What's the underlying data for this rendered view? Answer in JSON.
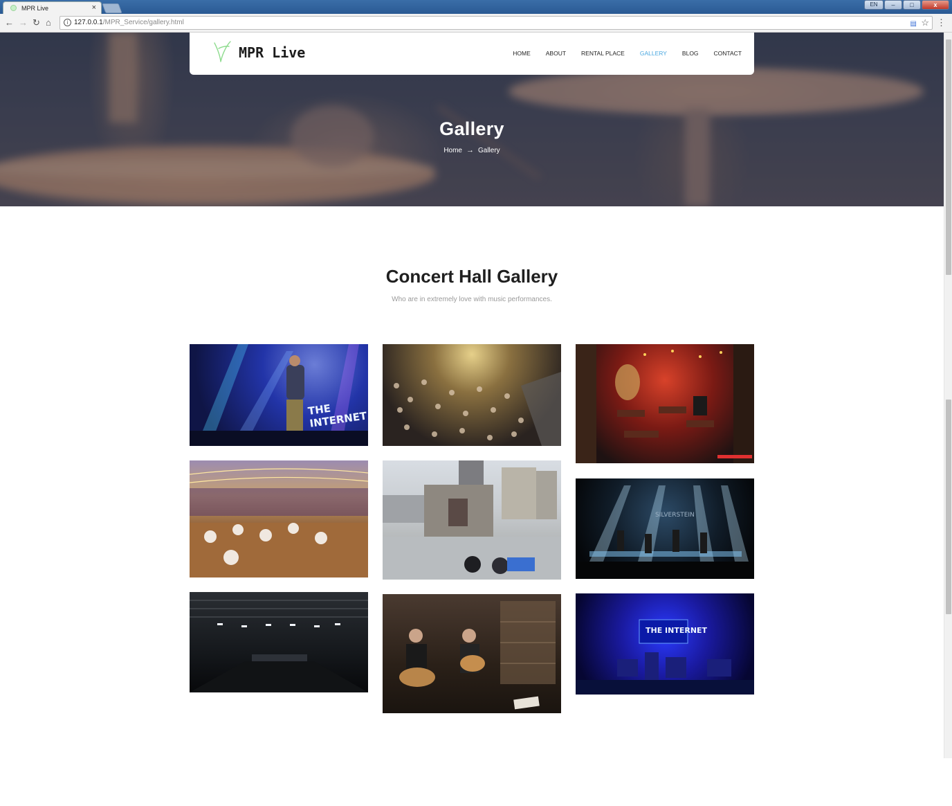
{
  "browser": {
    "tab_title": "MPR Live",
    "tab_close": "×",
    "url_host": "127.0.0.1",
    "url_path": "/MPR_Service/gallery.html",
    "ime_label": "EN",
    "minimize": "–",
    "maximize": "□",
    "close": "x"
  },
  "site": {
    "logo_text": "MPR Live",
    "nav": [
      "HOME",
      "ABOUT",
      "RENTAL PLACE",
      "GALLERY",
      "BLOG",
      "CONTACT"
    ],
    "active_nav": "GALLERY",
    "accent_color": "#4aa8e0"
  },
  "hero": {
    "title": "Gallery",
    "breadcrumb": [
      "Home",
      "Gallery"
    ]
  },
  "gallery": {
    "title": "Concert Hall Gallery",
    "subtitle": "Who are in extremely love with music performances.",
    "photos": [
      {
        "name": "singer-on-stage",
        "caption": "THE INTERNET"
      },
      {
        "name": "crowd-concert"
      },
      {
        "name": "red-club-interior"
      },
      {
        "name": "rooftop-string-lights"
      },
      {
        "name": "rooftop-acoustic-stage"
      },
      {
        "name": "band-stage-lights"
      },
      {
        "name": "empty-concert-hall"
      },
      {
        "name": "acoustic-duo-studio"
      },
      {
        "name": "blue-stage-screen",
        "caption": "THE INTERNET"
      }
    ]
  }
}
